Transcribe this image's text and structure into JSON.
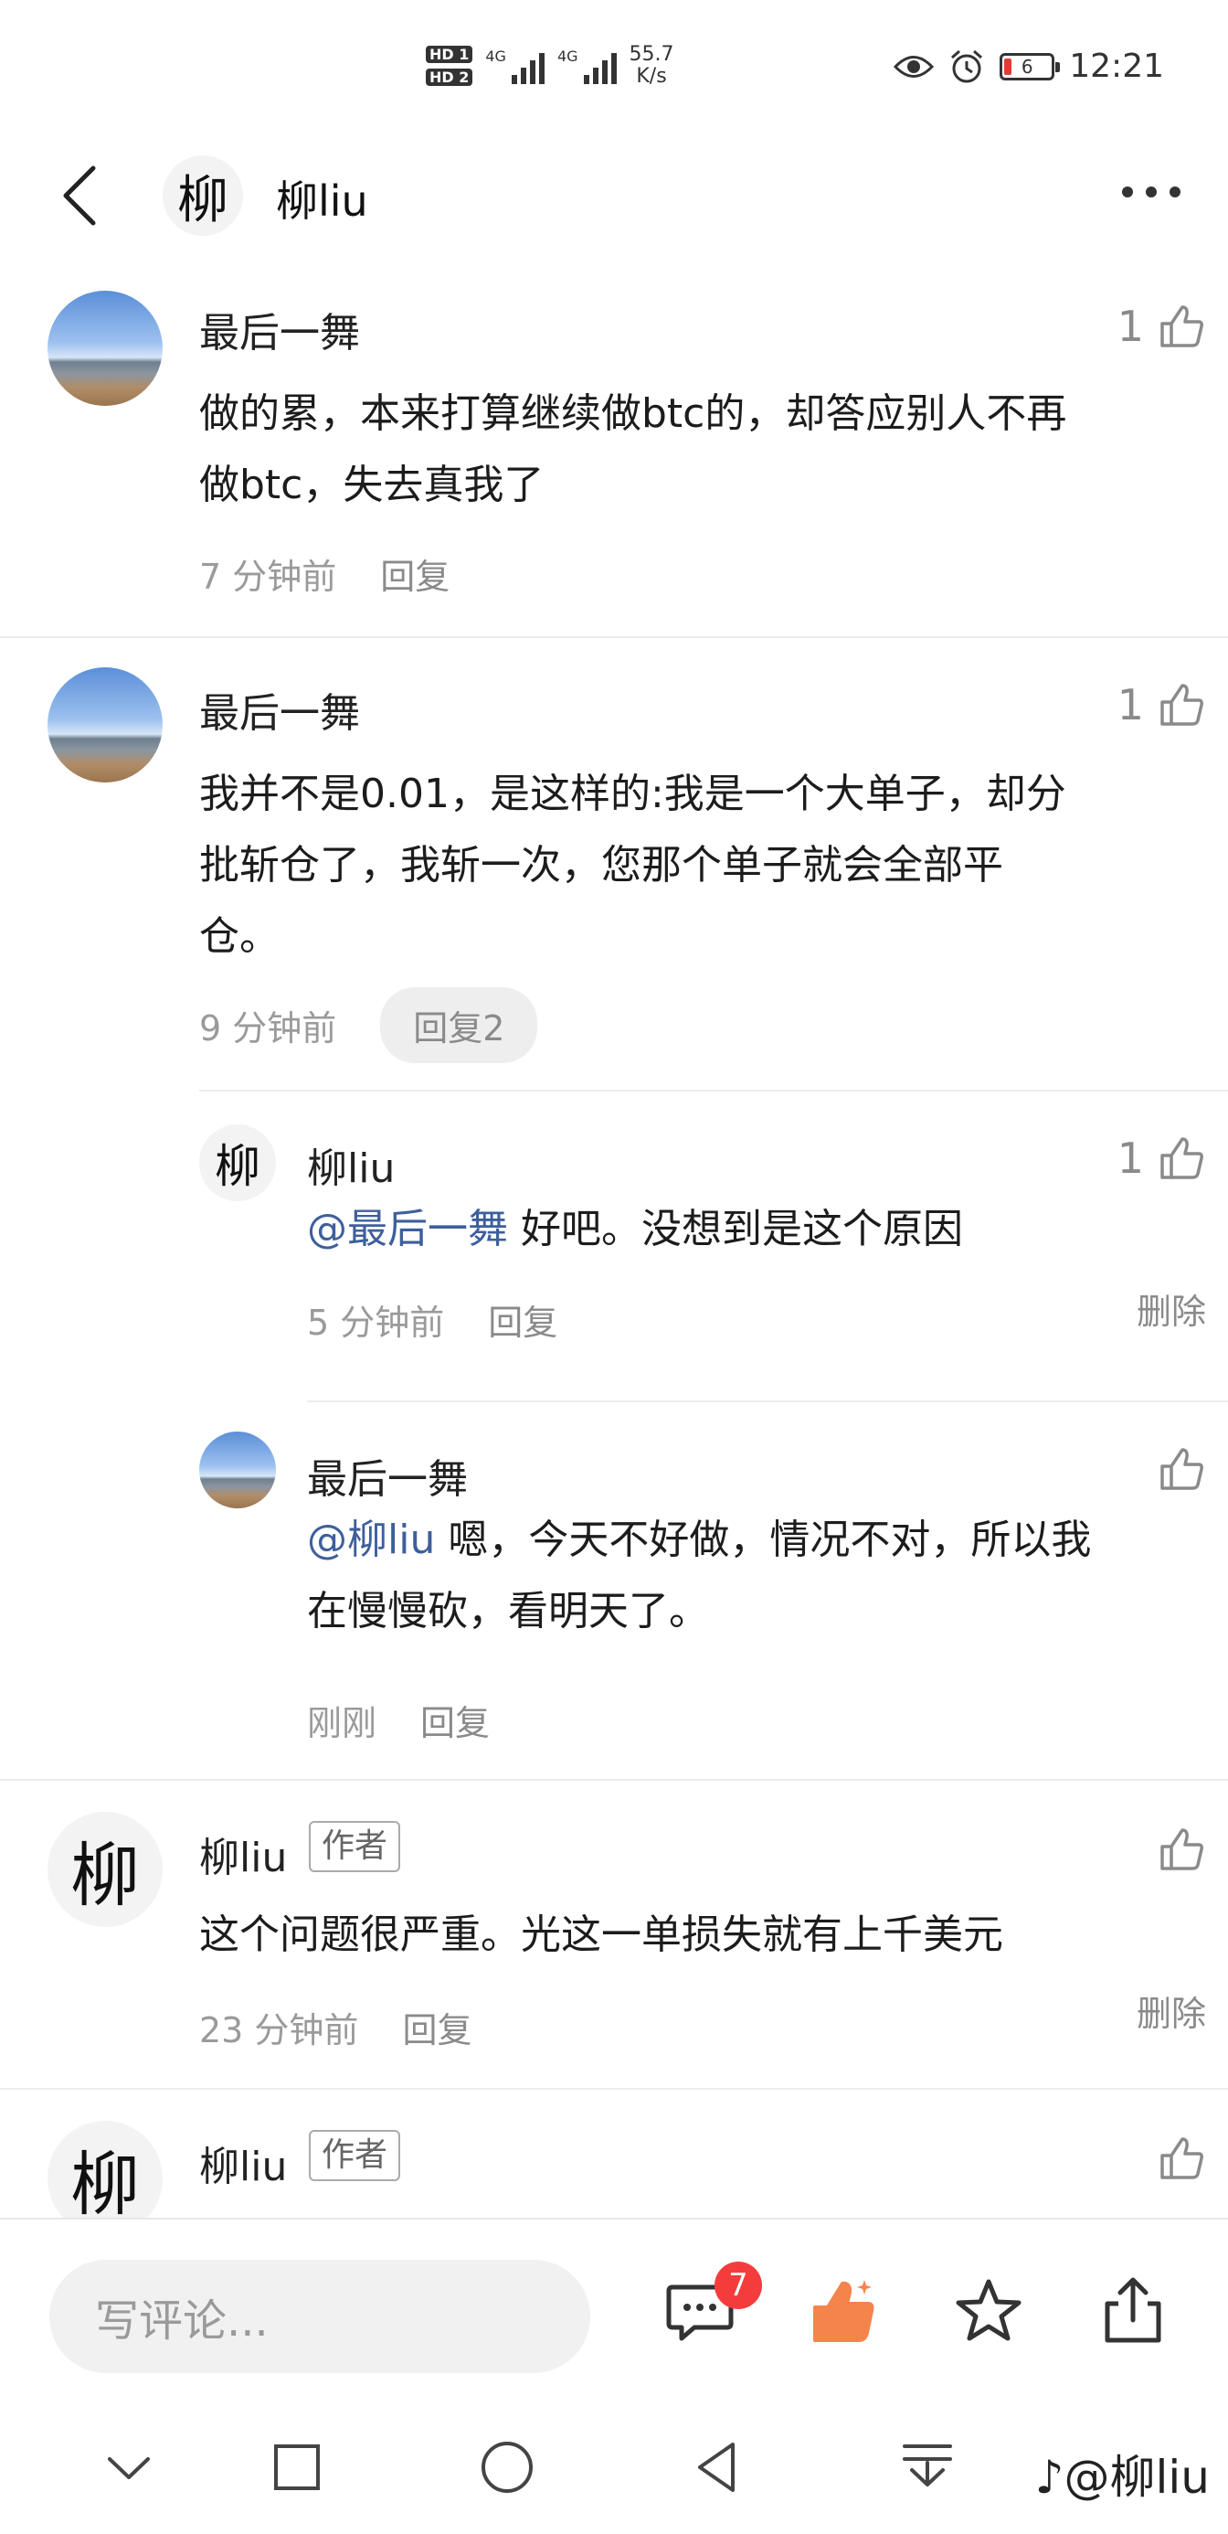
{
  "status_bar": {
    "hd1": "HD 1",
    "hd2": "HD 2",
    "net1": "4G",
    "net2": "4G",
    "speed_value": "55.7",
    "speed_unit": "K/s",
    "battery": "6",
    "time": "12:21"
  },
  "header": {
    "avatar_char": "柳",
    "title": "柳liu"
  },
  "comments": [
    {
      "name": "最后一舞",
      "likes": "1",
      "text_lines": [
        "做的累，本来打算继续做btc的，却答应别人不再",
        "做btc，失去真我了"
      ],
      "time": "7 分钟前",
      "reply": "回复"
    },
    {
      "name": "最后一舞",
      "likes": "1",
      "text_lines": [
        "我并不是0.01，是这样的:我是一个大单子，却分",
        "批斩仓了，我斩一次，您那个单子就会全部平",
        "仓。"
      ],
      "time": "9 分钟前",
      "reply": "回复2"
    }
  ],
  "replies": [
    {
      "avatar_char": "柳",
      "name": "柳liu",
      "likes": "1",
      "mention": "@最后一舞",
      "text": " 好吧。没想到是这个原因",
      "time": "5 分钟前",
      "reply": "回复",
      "delete": "删除"
    },
    {
      "name": "最后一舞",
      "likes": "",
      "mention": "@柳liu",
      "text_line1": " 嗯，今天不好做，情况不对，所以我",
      "text_line2": "在慢慢砍，看明天了。",
      "time": "刚刚",
      "reply": "回复"
    }
  ],
  "author_comments": [
    {
      "avatar_char": "柳",
      "name": "柳liu",
      "tag": "作者",
      "text": "这个问题很严重。光这一单损失就有上千美元",
      "time": "23 分钟前",
      "reply": "回复",
      "delete": "删除"
    },
    {
      "avatar_char": "柳",
      "name": "柳liu",
      "tag": "作者"
    }
  ],
  "bottom_bar": {
    "placeholder": "写评论...",
    "comment_badge": "7",
    "like_color": "#f5844c"
  },
  "watermark": "@柳liu",
  "icons": [
    "back-icon",
    "more-icon",
    "thumb-up-icon",
    "comment-icon",
    "star-icon",
    "share-icon",
    "chevron-down-icon",
    "square-icon",
    "circle-icon",
    "triangle-back-icon",
    "notification-down-icon",
    "douyin-icon"
  ]
}
